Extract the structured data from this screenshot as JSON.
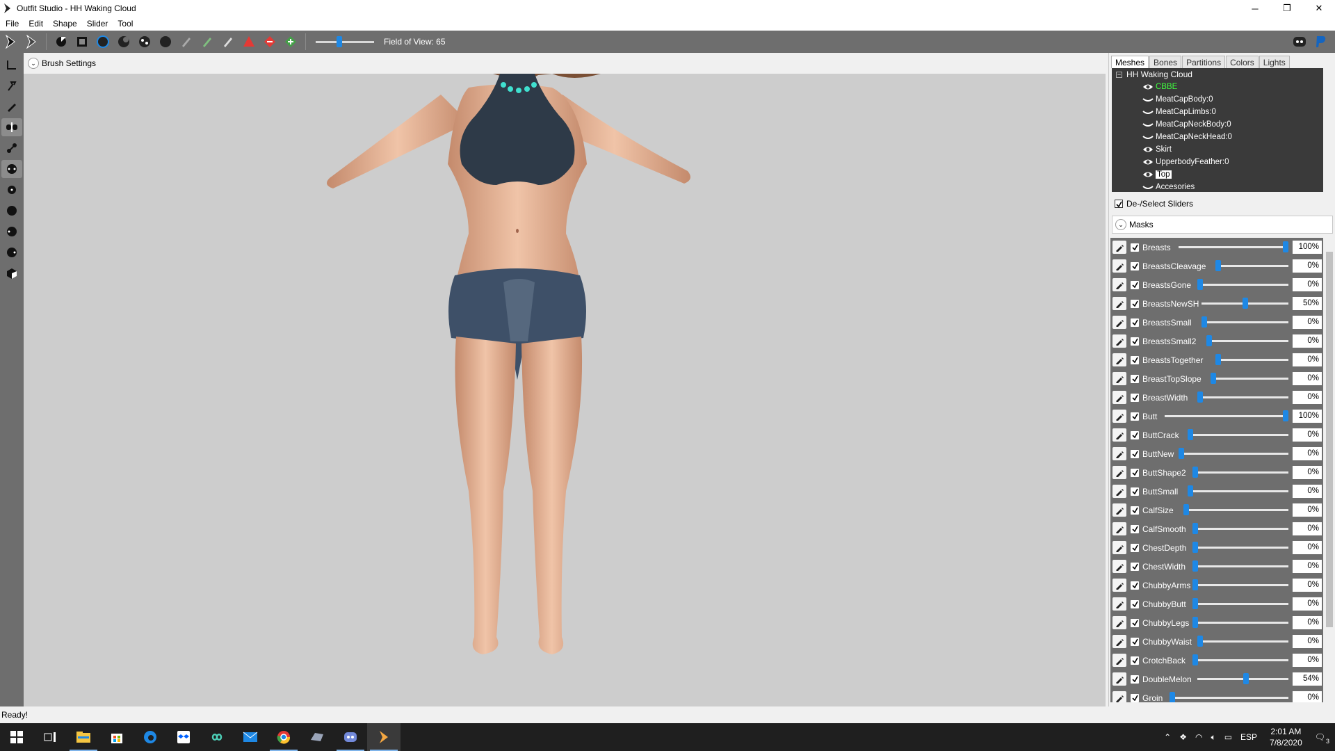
{
  "window": {
    "title": "Outfit Studio - HH Waking Cloud",
    "controls": {
      "minimize": "─",
      "restore": "❐",
      "close": "✕"
    }
  },
  "menu": [
    "File",
    "Edit",
    "Shape",
    "Slider",
    "Tool"
  ],
  "toolbar": {
    "fov_label": "Field of View: 65",
    "fov_value": 0.4
  },
  "brush_settings": {
    "label": "Brush Settings"
  },
  "panel": {
    "tabs": [
      "Meshes",
      "Bones",
      "Partitions",
      "Colors",
      "Lights"
    ],
    "active_tab": "Meshes",
    "tree": {
      "root": "HH Waking Cloud",
      "items": [
        {
          "label": "CBBE",
          "icon": "eye-icon",
          "style": "green"
        },
        {
          "label": "MeatCapBody:0",
          "icon": "eye-closed-icon",
          "style": ""
        },
        {
          "label": "MeatCapLimbs:0",
          "icon": "eye-closed-icon",
          "style": ""
        },
        {
          "label": "MeatCapNeckBody:0",
          "icon": "eye-closed-icon",
          "style": ""
        },
        {
          "label": "MeatCapNeckHead:0",
          "icon": "eye-closed-icon",
          "style": ""
        },
        {
          "label": "Skirt",
          "icon": "eye-icon",
          "style": ""
        },
        {
          "label": "UpperbodyFeather:0",
          "icon": "eye-icon",
          "style": ""
        },
        {
          "label": "Top",
          "icon": "eye-icon",
          "style": "selected"
        },
        {
          "label": "Accesories",
          "icon": "eye-closed-icon",
          "style": ""
        }
      ]
    },
    "deselect_label": "De-/Select Sliders",
    "masks_label": "Masks"
  },
  "sliders": [
    {
      "name": "Breasts",
      "value": "100%",
      "level": 1.0
    },
    {
      "name": "BreastsCleavage",
      "value": "0%",
      "level": 0.0
    },
    {
      "name": "BreastsGone",
      "value": "0%",
      "level": 0.0
    },
    {
      "name": "BreastsNewSH",
      "value": "50%",
      "level": 0.5
    },
    {
      "name": "BreastsSmall",
      "value": "0%",
      "level": 0.0
    },
    {
      "name": "BreastsSmall2",
      "value": "0%",
      "level": 0.0
    },
    {
      "name": "BreastsTogether",
      "value": "0%",
      "level": 0.0
    },
    {
      "name": "BreastTopSlope",
      "value": "0%",
      "level": 0.0
    },
    {
      "name": "BreastWidth",
      "value": "0%",
      "level": 0.0
    },
    {
      "name": "Butt",
      "value": "100%",
      "level": 1.0
    },
    {
      "name": "ButtCrack",
      "value": "0%",
      "level": 0.0
    },
    {
      "name": "ButtNew",
      "value": "0%",
      "level": 0.0
    },
    {
      "name": "ButtShape2",
      "value": "0%",
      "level": 0.0
    },
    {
      "name": "ButtSmall",
      "value": "0%",
      "level": 0.0
    },
    {
      "name": "CalfSize",
      "value": "0%",
      "level": 0.0
    },
    {
      "name": "CalfSmooth",
      "value": "0%",
      "level": 0.0
    },
    {
      "name": "ChestDepth",
      "value": "0%",
      "level": 0.0
    },
    {
      "name": "ChestWidth",
      "value": "0%",
      "level": 0.0
    },
    {
      "name": "ChubbyArms",
      "value": "0%",
      "level": 0.0
    },
    {
      "name": "ChubbyButt",
      "value": "0%",
      "level": 0.0
    },
    {
      "name": "ChubbyLegs",
      "value": "0%",
      "level": 0.0
    },
    {
      "name": "ChubbyWaist",
      "value": "0%",
      "level": 0.0
    },
    {
      "name": "CrotchBack",
      "value": "0%",
      "level": 0.0
    },
    {
      "name": "DoubleMelon",
      "value": "54%",
      "level": 0.54
    },
    {
      "name": "Groin",
      "value": "0%",
      "level": 0.0
    }
  ],
  "status": "Ready!",
  "taskbar": {
    "lang": "ESP",
    "time": "2:01 AM",
    "date": "7/8/2020",
    "notifications": "3"
  },
  "colors": {
    "accent": "#1e88e5",
    "panel_dark": "#6e6e6e",
    "tree_bg": "#3a3a3a"
  }
}
